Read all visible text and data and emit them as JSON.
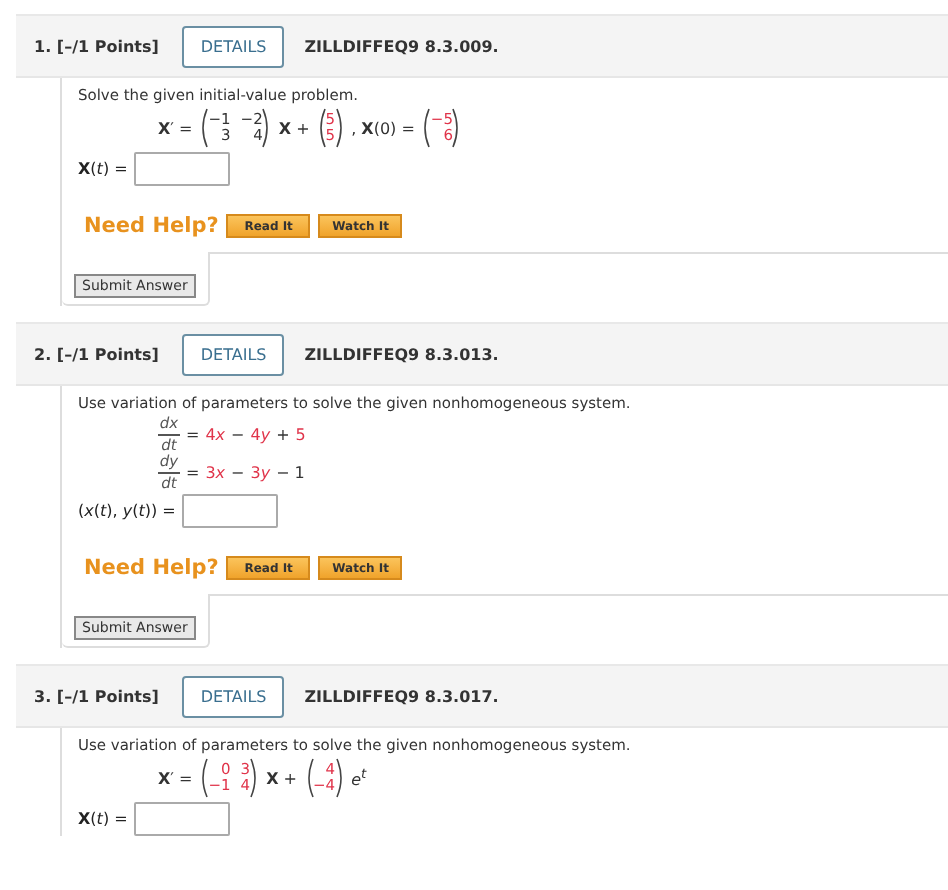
{
  "problems": [
    {
      "number": "1.",
      "points": "[–/1 Points]",
      "details": "DETAILS",
      "code": "ZILLDIFFEQ9 8.3.009.",
      "prompt": "Solve the given initial-value problem.",
      "equation": [
        [
          {
            "kind": "text",
            "text": "**X**′ =",
            "red": false
          },
          {
            "kind": "matrix",
            "rows": [
              [
                {
                  "text": "−1",
                  "red": false
                },
                {
                  "text": "−2",
                  "red": false
                }
              ],
              [
                {
                  "text": "3",
                  "red": false
                },
                {
                  "text": "4",
                  "red": false
                }
              ]
            ]
          },
          {
            "kind": "text",
            "text": "**X** +",
            "red": false
          },
          {
            "kind": "matrix",
            "rows": [
              [
                {
                  "text": "5",
                  "red": true
                }
              ],
              [
                {
                  "text": "5",
                  "red": true
                }
              ]
            ]
          },
          {
            "kind": "text",
            "text": ",   **X**(0) =",
            "red": false
          },
          {
            "kind": "matrix",
            "rows": [
              [
                {
                  "text": "−5",
                  "red": true
                }
              ],
              [
                {
                  "text": "6",
                  "red": true
                }
              ]
            ]
          }
        ]
      ],
      "answer_label": "**X**(*t*) =",
      "help": {
        "label": "Need Help?",
        "buttons": [
          "Read It",
          "Watch It"
        ]
      },
      "submit": "Submit Answer"
    },
    {
      "number": "2.",
      "points": "[–/1 Points]",
      "details": "DETAILS",
      "code": "ZILLDIFFEQ9 8.3.013.",
      "prompt": "Use variation of parameters to solve the given nonhomogeneous system.",
      "equation": [
        [
          {
            "kind": "fraction",
            "num": "*dx*",
            "den": "*dt*"
          },
          {
            "kind": "text",
            "text": "=",
            "red": false
          },
          {
            "kind": "term",
            "coef": "4",
            "var": "x",
            "red": true
          },
          {
            "kind": "text",
            "text": "−",
            "red": false
          },
          {
            "kind": "term",
            "coef": "4",
            "var": "y",
            "red": true
          },
          {
            "kind": "text",
            "text": "+",
            "red": false
          },
          {
            "kind": "text",
            "text": "5",
            "red": true
          }
        ],
        [
          {
            "kind": "fraction",
            "num": "*dy*",
            "den": "*dt*"
          },
          {
            "kind": "text",
            "text": "=",
            "red": false
          },
          {
            "kind": "term",
            "coef": "3",
            "var": "x",
            "red": true
          },
          {
            "kind": "text",
            "text": "−",
            "red": false
          },
          {
            "kind": "term",
            "coef": "3",
            "var": "y",
            "red": true
          },
          {
            "kind": "text",
            "text": "− 1",
            "red": false
          }
        ]
      ],
      "answer_label": "(*x*(*t*), *y*(*t*)) =",
      "help": {
        "label": "Need Help?",
        "buttons": [
          "Read It",
          "Watch It"
        ]
      },
      "submit": "Submit Answer"
    },
    {
      "number": "3.",
      "points": "[–/1 Points]",
      "details": "DETAILS",
      "code": "ZILLDIFFEQ9 8.3.017.",
      "prompt": "Use variation of parameters to solve the given nonhomogeneous system.",
      "equation": [
        [
          {
            "kind": "text",
            "text": "**X**′ =",
            "red": false
          },
          {
            "kind": "matrix",
            "rows": [
              [
                {
                  "text": "0",
                  "red": true
                },
                {
                  "text": "3",
                  "red": true
                }
              ],
              [
                {
                  "text": "−1",
                  "red": true
                },
                {
                  "text": "4",
                  "red": true
                }
              ]
            ]
          },
          {
            "kind": "text",
            "text": "**X** +",
            "red": false
          },
          {
            "kind": "matrix",
            "rows": [
              [
                {
                  "text": "4",
                  "red": true
                }
              ],
              [
                {
                  "text": "−4",
                  "red": true
                }
              ]
            ]
          },
          {
            "kind": "power",
            "base": "e",
            "exp": "t"
          }
        ]
      ],
      "answer_label": "**X**(*t*) ="
    }
  ]
}
